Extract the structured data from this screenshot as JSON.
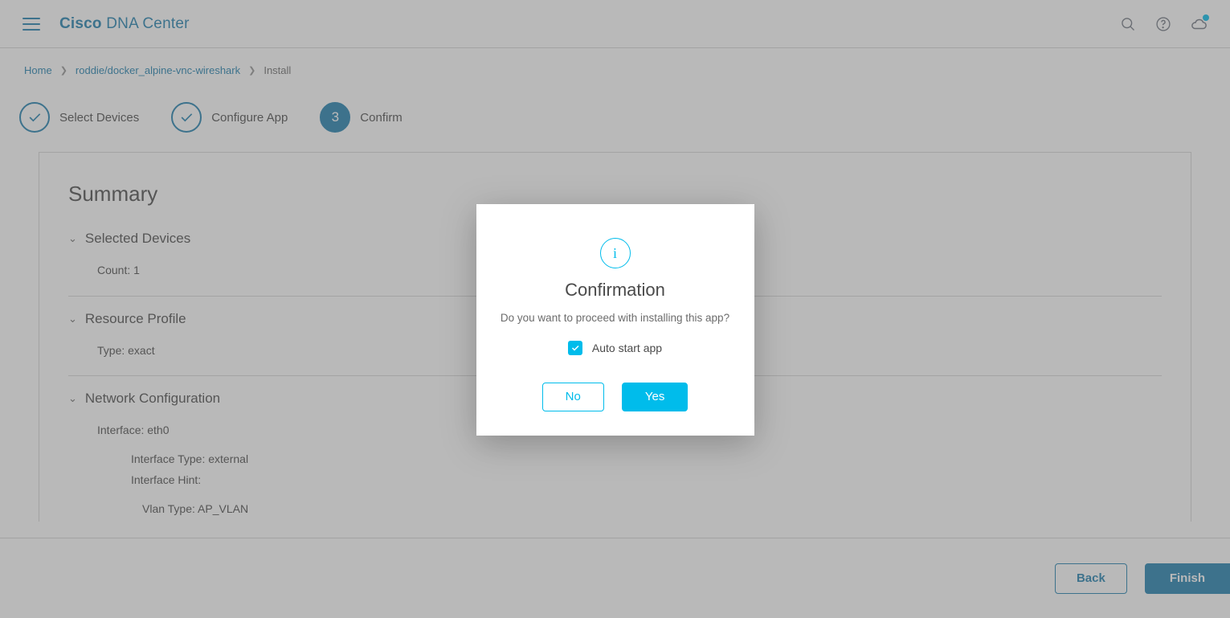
{
  "header": {
    "brand_bold": "Cisco",
    "brand_rest": "DNA Center"
  },
  "breadcrumb": {
    "home": "Home",
    "app": "roddie/docker_alpine-vnc-wireshark",
    "current": "Install"
  },
  "stepper": {
    "step1": "Select Devices",
    "step2": "Configure App",
    "step3_num": "3",
    "step3": "Confirm"
  },
  "summary": {
    "title": "Summary",
    "sections": {
      "devices": {
        "header": "Selected Devices",
        "count_label": "Count: 1"
      },
      "resource": {
        "header": "Resource Profile",
        "type_label": "Type: exact"
      },
      "network": {
        "header": "Network Configuration",
        "iface": "Interface: eth0",
        "iface_type": "Interface Type: external",
        "iface_hint": "Interface Hint:",
        "vlan_type": "Vlan Type: AP_VLAN"
      }
    }
  },
  "footer": {
    "back": "Back",
    "finish": "Finish"
  },
  "modal": {
    "title": "Confirmation",
    "text": "Do you want to proceed with installing this app?",
    "checkbox_label": "Auto start app",
    "checkbox_checked": true,
    "no": "No",
    "yes": "Yes"
  }
}
